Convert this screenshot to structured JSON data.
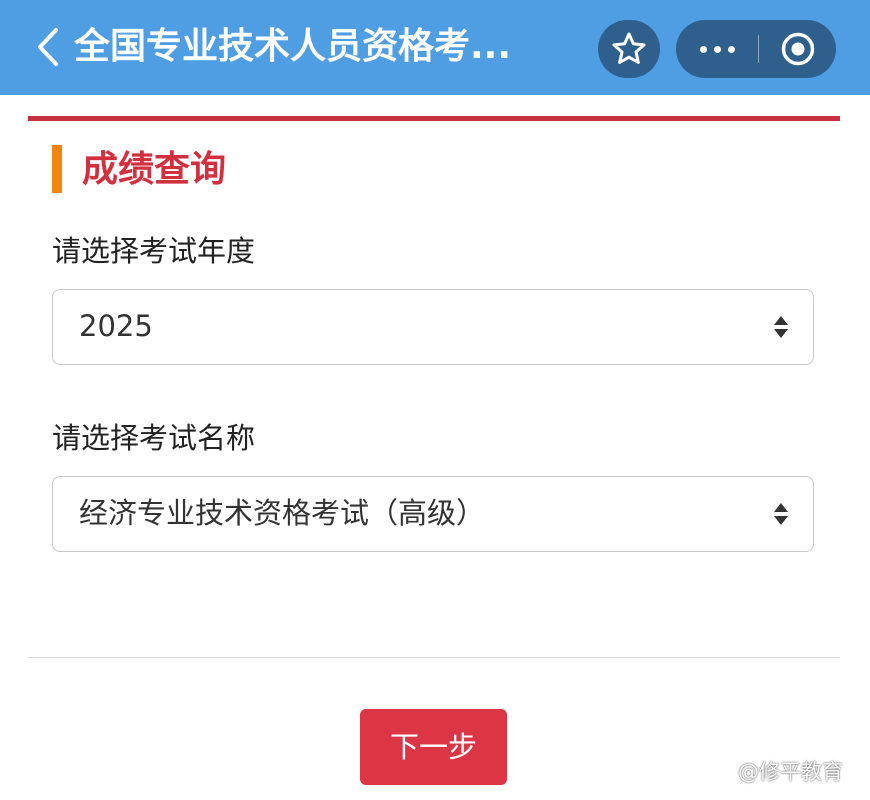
{
  "header": {
    "title": "全国专业技术人员资格考...",
    "icons": {
      "back": "back-chevron-icon",
      "favorite": "star-icon",
      "more": "more-dots-icon",
      "close": "target-circle-icon"
    }
  },
  "section": {
    "title": "成绩查询"
  },
  "form": {
    "year_label": "请选择考试年度",
    "year_value": "2025",
    "exam_label": "请选择考试名称",
    "exam_value": "经济专业技术资格考试（高级）"
  },
  "actions": {
    "next_label": "下一步"
  },
  "watermark": {
    "text": "@修平教育"
  },
  "colors": {
    "header_bg": "#4f9ee3",
    "capsule_bg": "#2e5f8d",
    "accent_red": "#d22f3f",
    "marker_orange": "#f2850f",
    "button_red": "#dc3545"
  }
}
